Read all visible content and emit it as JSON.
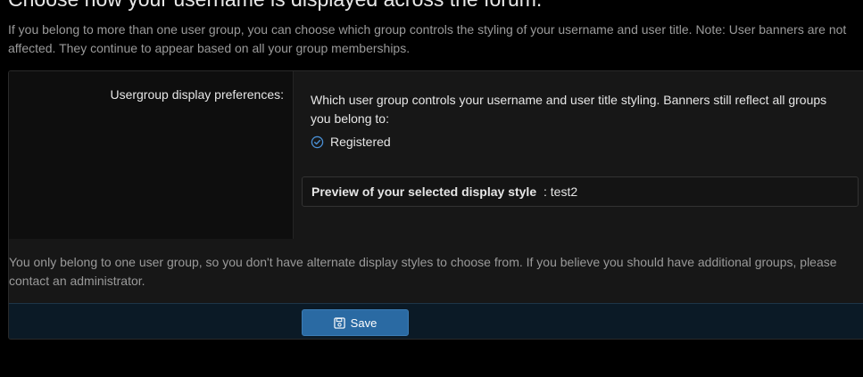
{
  "header": {
    "title": "Choose how your username is displayed across the forum.",
    "description": "If you belong to more than one user group, you can choose which group controls the styling of your username and user title. Note: User banners are not affected. They continue to appear based on all your group memberships."
  },
  "form": {
    "row_label": "Usergroup display preferences:",
    "hint": "Which user group controls your username and user title styling. Banners still reflect all groups you belong to:",
    "selected_group": "Registered",
    "preview": {
      "label": "Preview of your selected display style",
      "separator": " : ",
      "value": "test2"
    },
    "note": "You only belong to one user group, so you don't have alternate display styles to choose from. If you believe you should have additional groups, please contact an administrator."
  },
  "footer": {
    "save_label": "Save"
  },
  "icons": {
    "check": "check-circle-icon",
    "save": "save-icon"
  },
  "colors": {
    "accent": "#2a6aa3",
    "check": "#4a8fd4",
    "footer_bg": "#0b1a26"
  }
}
